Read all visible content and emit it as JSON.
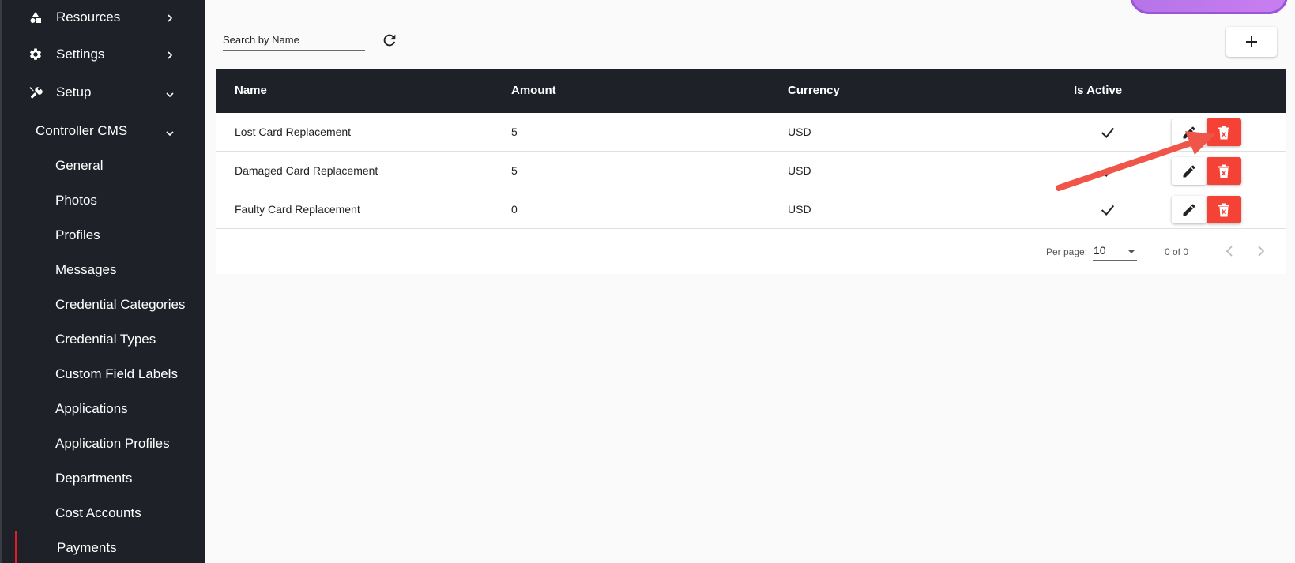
{
  "sidebar": {
    "top_items": [
      {
        "label": "Resources",
        "icon": "shapes-icon"
      },
      {
        "label": "Settings",
        "icon": "gear-icon"
      },
      {
        "label": "Setup",
        "icon": "tools-icon"
      }
    ],
    "group": {
      "label": "Controller CMS"
    },
    "sub_items": [
      {
        "label": "General"
      },
      {
        "label": "Photos"
      },
      {
        "label": "Profiles"
      },
      {
        "label": "Messages"
      },
      {
        "label": "Credential Categories"
      },
      {
        "label": "Credential Types"
      },
      {
        "label": "Custom Field Labels"
      },
      {
        "label": "Applications"
      },
      {
        "label": "Application Profiles"
      },
      {
        "label": "Departments"
      },
      {
        "label": "Cost Accounts"
      },
      {
        "label": "Payments"
      }
    ],
    "active_item": "Payments"
  },
  "toolbar": {
    "search_placeholder": "Search by Name",
    "refresh_icon": "refresh-icon",
    "add_icon": "plus-icon"
  },
  "table": {
    "columns": [
      "Name",
      "Amount",
      "Currency",
      "Is Active"
    ],
    "rows": [
      {
        "name": "Lost Card Replacement",
        "amount": "5",
        "currency": "USD",
        "active": true
      },
      {
        "name": "Damaged Card Replacement",
        "amount": "5",
        "currency": "USD",
        "active": true
      },
      {
        "name": "Faulty Card Replacement",
        "amount": "0",
        "currency": "USD",
        "active": true
      }
    ]
  },
  "pagination": {
    "per_page_label": "Per page:",
    "per_page_value": "10",
    "range_label": "0 of 0"
  },
  "colors": {
    "sidebar_bg": "#1e2128",
    "header_bg": "#1e2128",
    "delete_red": "#f44336",
    "active_marker": "#e11d2b",
    "annotation_arrow": "#f0554a",
    "brand_purple": "#b574e8"
  }
}
